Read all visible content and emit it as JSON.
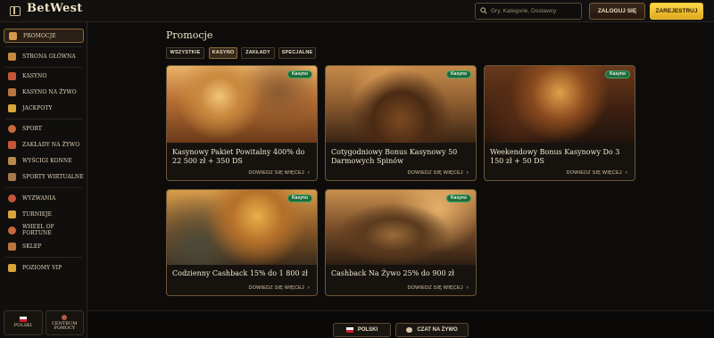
{
  "header": {
    "logo": "BetWest",
    "search_placeholder": "Gry, Kategorie, Dostawcy",
    "login_label": "ZALOGUJ SIĘ",
    "register_label": "ZAREJESTRUJ"
  },
  "sidebar": {
    "items": [
      {
        "label": "PROMOCJE",
        "icon": "gift-icon",
        "color": "#d39a4a",
        "active": true
      },
      {
        "label": "STRONA GŁÓWNA",
        "icon": "home-icon",
        "color": "#c98a3e"
      },
      {
        "label": "KASYNO",
        "icon": "cards-icon",
        "color": "#c4563a"
      },
      {
        "label": "KASYNO NA ŻYWO",
        "icon": "dealer-icon",
        "color": "#b8743e"
      },
      {
        "label": "JACKPOTY",
        "icon": "coins-icon",
        "color": "#d9a53a"
      },
      {
        "label": "SPORT",
        "icon": "ball-icon",
        "color": "#c46a3a"
      },
      {
        "label": "ZAKŁADY NA ŻYWO",
        "icon": "live-icon",
        "color": "#c4563a"
      },
      {
        "label": "WYŚCIGI KONNE",
        "icon": "horse-icon",
        "color": "#b88a4a"
      },
      {
        "label": "SPORTY WIRTUALNE",
        "icon": "joystick-icon",
        "color": "#a67a4a"
      },
      {
        "label": "WYZWANIA",
        "icon": "target-icon",
        "color": "#c4563a"
      },
      {
        "label": "TURNIEJE",
        "icon": "trophy-icon",
        "color": "#d9a53a"
      },
      {
        "label": "WHEEL OF FORTUNE",
        "icon": "wheel-icon",
        "color": "#c46a3a"
      },
      {
        "label": "SKLEP",
        "icon": "shop-icon",
        "color": "#b8743e"
      },
      {
        "label": "POZIOMY VIP",
        "icon": "crown-icon",
        "color": "#d9a53a"
      }
    ],
    "bottom": {
      "language": "POLSKI",
      "help": "CENTRUM POMOCY"
    }
  },
  "main": {
    "title": "Promocje",
    "tabs": [
      {
        "label": "WSZYSTKIE",
        "active": false
      },
      {
        "label": "KASYNO",
        "active": true
      },
      {
        "label": "ZAKŁADY",
        "active": false
      },
      {
        "label": "SPECJALNE",
        "active": false
      }
    ],
    "cards": [
      {
        "badge": "Kasyno",
        "title": "Kasynowy Pakiet Powitalny 400% do 22 500 zł + 350 DS",
        "link": "DOWIEDZ SIĘ WIĘCEJ"
      },
      {
        "badge": "Kasyno",
        "title": "Cotygodniowy Bonus Kasynowy 50 Darmowych Spinów",
        "link": "DOWIEDZ SIĘ WIĘCEJ"
      },
      {
        "badge": "Kasyno",
        "title": "Weekendowy Bonus Kasynowy Do 3 150 zł + 50 DS",
        "link": "DOWIEDZ SIĘ WIĘCEJ"
      },
      {
        "badge": "Kasyno",
        "title": "Codzienny Cashback 15% do 1 800 zł",
        "link": "DOWIEDZ SIĘ WIĘCEJ"
      },
      {
        "badge": "Kasyno",
        "title": "Cashback Na Żywo 25% do 900 zł",
        "link": "DOWIEDZ SIĘ WIĘCEJ"
      }
    ]
  },
  "footer": {
    "language_label": "POLSKI",
    "chat_label": "CZAT NA ŻYWO"
  }
}
